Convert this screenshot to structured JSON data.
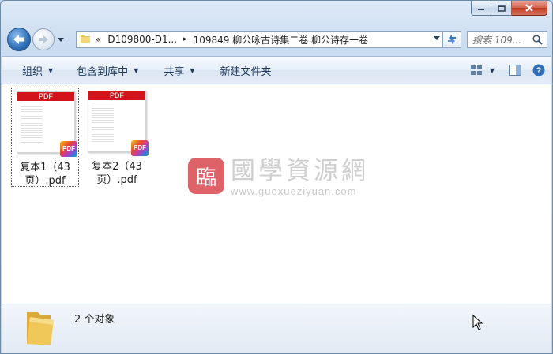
{
  "window": {
    "caption_buttons": [
      "minimize-icon",
      "maximize-icon",
      "close-icon"
    ]
  },
  "navigation": {
    "back_icon": "back-arrow-icon",
    "forward_icon": "forward-arrow-icon",
    "history_icon": "chevron-down-icon"
  },
  "address": {
    "overflow": "«",
    "segments": [
      "D109800-D1...",
      "109849 柳公咏古诗集二卷 柳公诗存一卷"
    ],
    "separator": "▸"
  },
  "search": {
    "placeholder": "搜索 109..."
  },
  "toolbar": {
    "organize": "组织",
    "include_in_library": "包含到库中",
    "share": "共享",
    "new_folder": "新建文件夹"
  },
  "files": [
    {
      "name_line1": "复本1（43",
      "name_line2": "页）.pdf",
      "thumb_header": "PDF",
      "badge": "PDF",
      "selected": true
    },
    {
      "name_line1": "复本2（43",
      "name_line2": "页）.pdf",
      "thumb_header": "PDF",
      "badge": "PDF",
      "selected": false
    }
  ],
  "watermark": {
    "logo_char": "臨",
    "title": "國學資源網",
    "url": "www.guoxueziyuan.com"
  },
  "details": {
    "count": "2 个对象"
  },
  "colors": {
    "pdf_red": "#d3131b",
    "nav_blue": "#2f6fb8",
    "close_red": "#c23b21"
  }
}
